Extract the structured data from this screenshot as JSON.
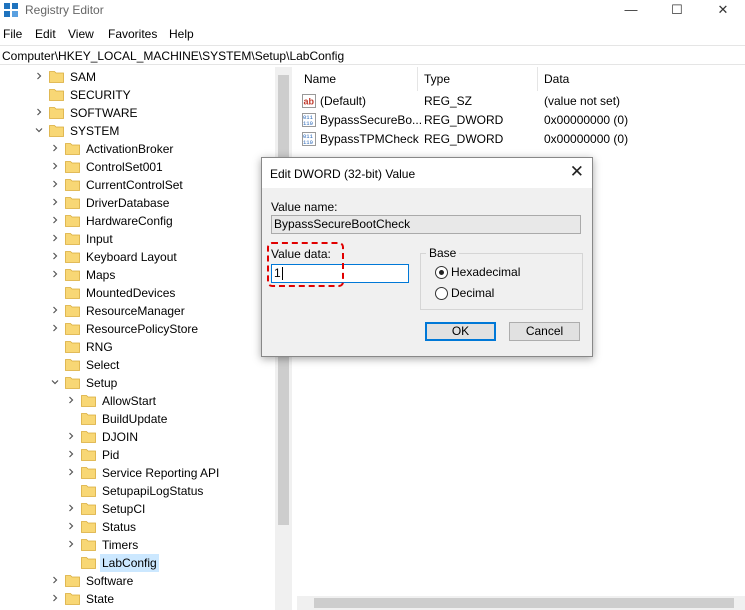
{
  "window": {
    "title": "Registry Editor",
    "minimize": "—",
    "maximize": "☐",
    "close": "✕"
  },
  "menu": [
    "File",
    "Edit",
    "View",
    "Favorites",
    "Help"
  ],
  "address": "Computer\\HKEY_LOCAL_MACHINE\\SYSTEM\\Setup\\LabConfig",
  "tree": [
    {
      "label": "SAM",
      "depth": 0,
      "expander": "collapsed"
    },
    {
      "label": "SECURITY",
      "depth": 0,
      "expander": "none"
    },
    {
      "label": "SOFTWARE",
      "depth": 0,
      "expander": "collapsed"
    },
    {
      "label": "SYSTEM",
      "depth": 0,
      "expander": "expanded"
    },
    {
      "label": "ActivationBroker",
      "depth": 1,
      "expander": "collapsed"
    },
    {
      "label": "ControlSet001",
      "depth": 1,
      "expander": "collapsed"
    },
    {
      "label": "CurrentControlSet",
      "depth": 1,
      "expander": "collapsed"
    },
    {
      "label": "DriverDatabase",
      "depth": 1,
      "expander": "collapsed"
    },
    {
      "label": "HardwareConfig",
      "depth": 1,
      "expander": "collapsed"
    },
    {
      "label": "Input",
      "depth": 1,
      "expander": "collapsed"
    },
    {
      "label": "Keyboard Layout",
      "depth": 1,
      "expander": "collapsed"
    },
    {
      "label": "Maps",
      "depth": 1,
      "expander": "collapsed"
    },
    {
      "label": "MountedDevices",
      "depth": 1,
      "expander": "none"
    },
    {
      "label": "ResourceManager",
      "depth": 1,
      "expander": "collapsed"
    },
    {
      "label": "ResourcePolicyStore",
      "depth": 1,
      "expander": "collapsed"
    },
    {
      "label": "RNG",
      "depth": 1,
      "expander": "none"
    },
    {
      "label": "Select",
      "depth": 1,
      "expander": "none"
    },
    {
      "label": "Setup",
      "depth": 1,
      "expander": "expanded"
    },
    {
      "label": "AllowStart",
      "depth": 2,
      "expander": "collapsed"
    },
    {
      "label": "BuildUpdate",
      "depth": 2,
      "expander": "none"
    },
    {
      "label": "DJOIN",
      "depth": 2,
      "expander": "collapsed"
    },
    {
      "label": "Pid",
      "depth": 2,
      "expander": "collapsed"
    },
    {
      "label": "Service Reporting API",
      "depth": 2,
      "expander": "collapsed"
    },
    {
      "label": "SetupapiLogStatus",
      "depth": 2,
      "expander": "none"
    },
    {
      "label": "SetupCI",
      "depth": 2,
      "expander": "collapsed"
    },
    {
      "label": "Status",
      "depth": 2,
      "expander": "collapsed"
    },
    {
      "label": "Timers",
      "depth": 2,
      "expander": "collapsed"
    },
    {
      "label": "LabConfig",
      "depth": 2,
      "expander": "none",
      "selected": true
    },
    {
      "label": "Software",
      "depth": 1,
      "expander": "collapsed"
    },
    {
      "label": "State",
      "depth": 1,
      "expander": "collapsed"
    }
  ],
  "columns": {
    "name": "Name",
    "type": "Type",
    "data": "Data"
  },
  "values": [
    {
      "name": "(Default)",
      "type": "REG_SZ",
      "data": "(value not set)",
      "icon": "string-value-icon"
    },
    {
      "name": "BypassSecureBo...",
      "type": "REG_DWORD",
      "data": "0x00000000 (0)",
      "icon": "dword-value-icon"
    },
    {
      "name": "BypassTPMCheck",
      "type": "REG_DWORD",
      "data": "0x00000000 (0)",
      "icon": "dword-value-icon"
    }
  ],
  "dialog": {
    "title": "Edit DWORD (32-bit) Value",
    "close": "✕",
    "value_name_label": "Value name:",
    "value_name": "BypassSecureBootCheck",
    "value_data_label": "Value data:",
    "value_data": "1",
    "base_label": "Base",
    "hex_label": "Hexadecimal",
    "dec_label": "Decimal",
    "selected_base": "hexadecimal",
    "ok": "OK",
    "cancel": "Cancel"
  },
  "colors": {
    "accent": "#0078d7",
    "highlight": "#e00000",
    "folder": "#f8d775",
    "selection": "#cce8ff"
  }
}
